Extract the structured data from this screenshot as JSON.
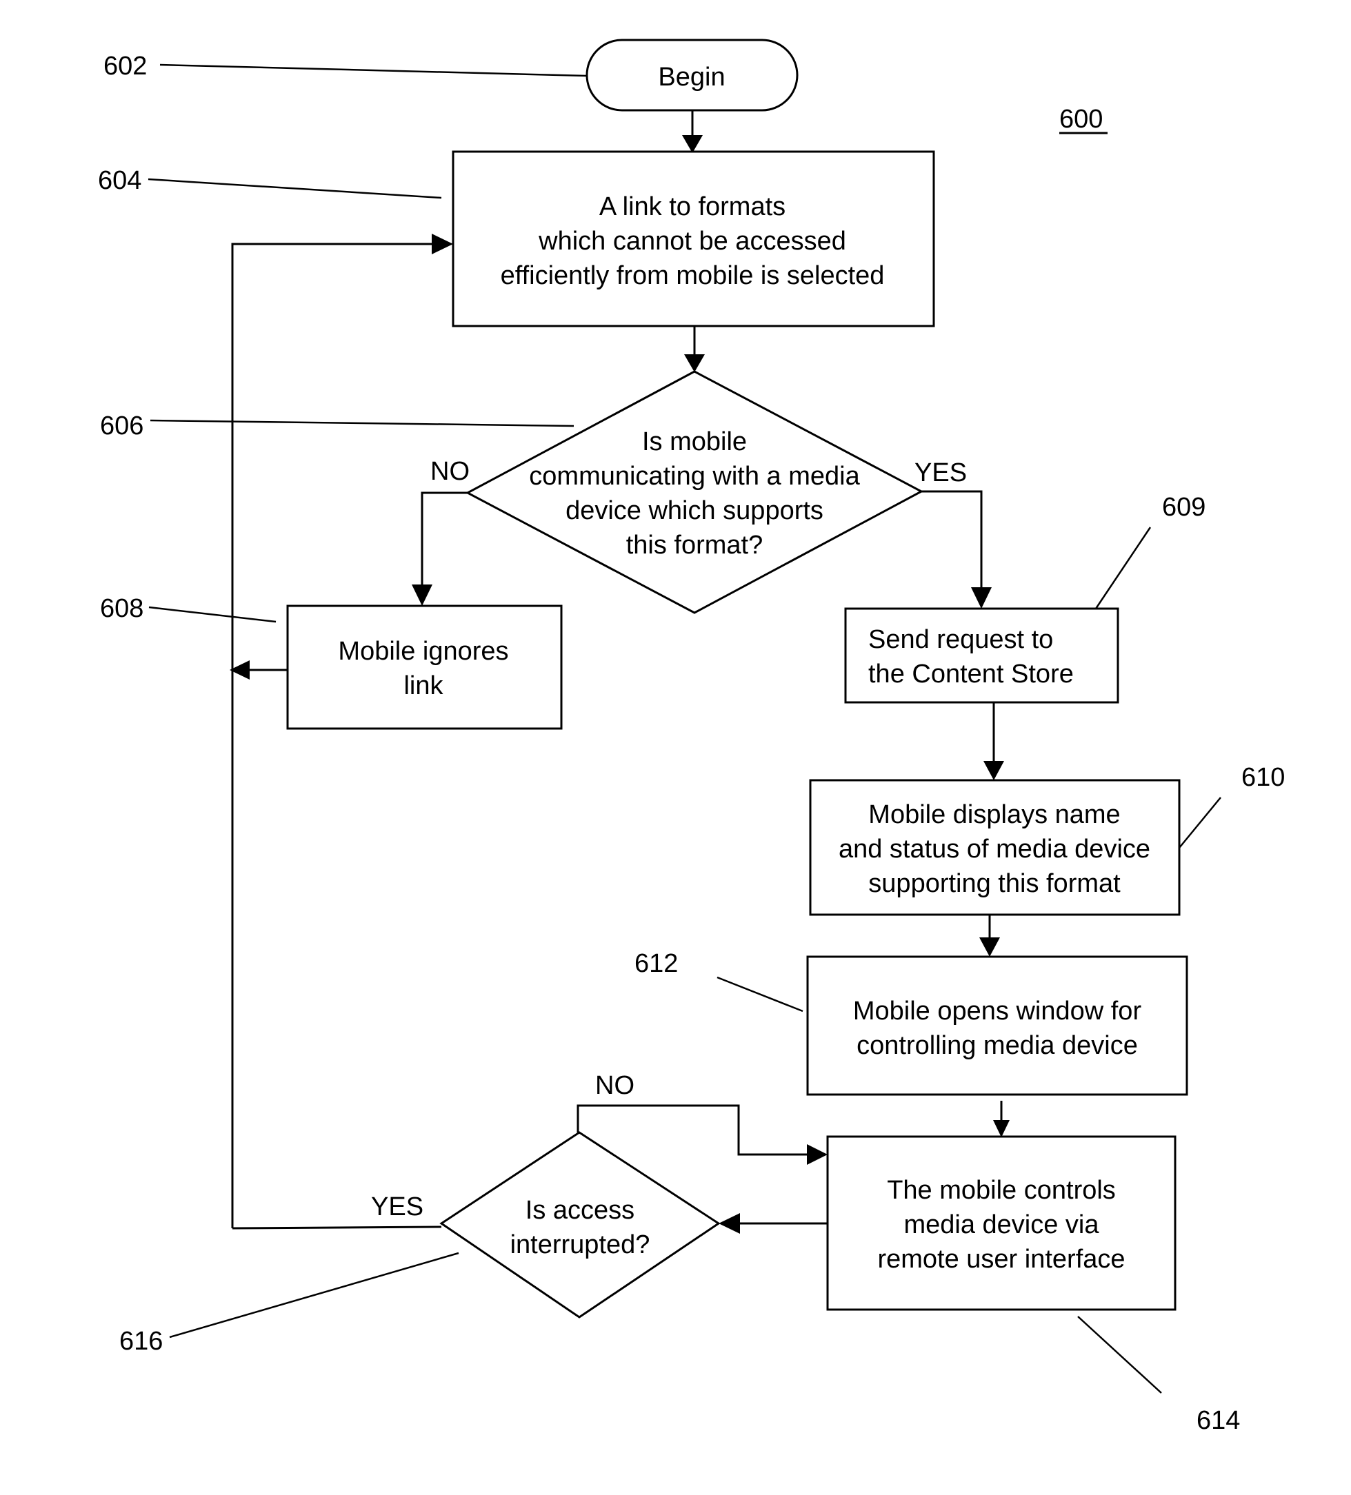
{
  "figure": {
    "number": "600",
    "nodes": {
      "begin": {
        "ref": "602",
        "type": "terminal",
        "lines": [
          "Begin"
        ]
      },
      "select_link": {
        "ref": "604",
        "type": "process",
        "lines": [
          "A link to formats",
          "which cannot be accessed",
          "efficiently from mobile is selected"
        ]
      },
      "decision_media": {
        "ref": "606",
        "type": "decision",
        "lines": [
          "Is mobile",
          "communicating with a media",
          "device which supports",
          "this format?"
        ],
        "no_label": "NO",
        "yes_label": "YES"
      },
      "ignore": {
        "ref": "608",
        "type": "process",
        "lines": [
          "Mobile ignores",
          "link"
        ]
      },
      "send_request": {
        "ref": "609",
        "type": "process",
        "lines": [
          "Send request to",
          "the Content Store"
        ]
      },
      "display": {
        "ref": "610",
        "type": "process",
        "lines": [
          "Mobile displays name",
          "and status of media device",
          "supporting this format"
        ]
      },
      "open_window": {
        "ref": "612",
        "type": "process",
        "lines": [
          "Mobile opens window for",
          "controlling media device"
        ]
      },
      "control": {
        "ref": "614",
        "type": "process",
        "lines": [
          "The mobile controls",
          "media device via",
          "remote user interface"
        ]
      },
      "decision_interrupt": {
        "ref": "616",
        "type": "decision",
        "lines": [
          "Is access",
          "interrupted?"
        ],
        "no_label": "NO",
        "yes_label": "YES"
      }
    },
    "edges": [
      {
        "from": "begin",
        "to": "select_link"
      },
      {
        "from": "select_link",
        "to": "decision_media"
      },
      {
        "from": "decision_media",
        "to": "ignore",
        "label": "NO"
      },
      {
        "from": "decision_media",
        "to": "send_request",
        "label": "YES"
      },
      {
        "from": "ignore",
        "to": "select_link"
      },
      {
        "from": "send_request",
        "to": "display"
      },
      {
        "from": "display",
        "to": "open_window"
      },
      {
        "from": "open_window",
        "to": "control"
      },
      {
        "from": "control",
        "to": "decision_interrupt"
      },
      {
        "from": "decision_interrupt",
        "to": "control",
        "label": "NO"
      },
      {
        "from": "decision_interrupt",
        "to": "select_link",
        "label": "YES"
      }
    ]
  }
}
